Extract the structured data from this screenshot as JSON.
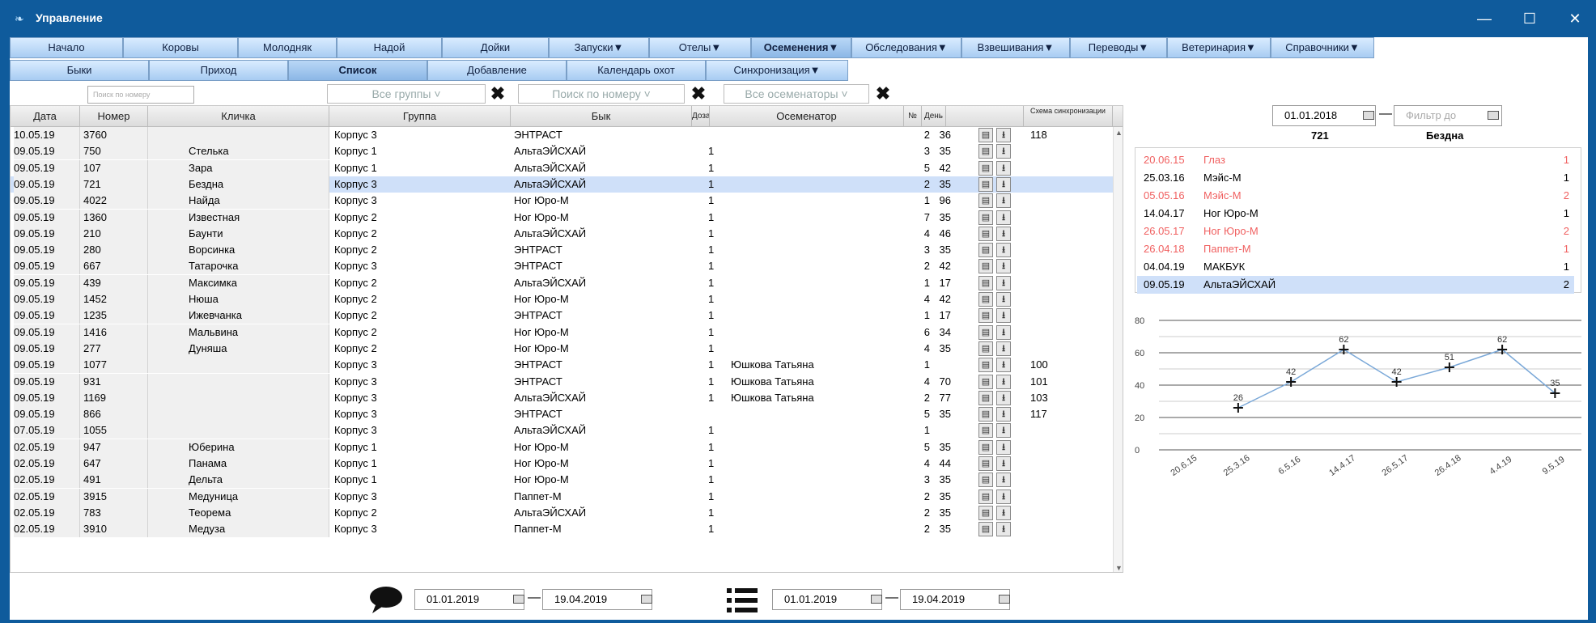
{
  "window": {
    "title": "Управление"
  },
  "menu": [
    "Начало",
    "Коровы",
    "Молодняк",
    "Надой",
    "Дойки",
    "Запуски▼",
    "Отелы▼",
    "Осеменения▼",
    "Обследования▼",
    "Взвешивания▼",
    "Переводы▼",
    "Ветеринария▼",
    "Справочники▼"
  ],
  "submenu": [
    "Быки",
    "Приход",
    "Список",
    "Добавление",
    "Календарь охот",
    "Синхронизация▼"
  ],
  "filters": {
    "number_search": "Поиск по номеру",
    "groups": "Все группы",
    "bull_search": "Поиск по номеру",
    "inseminators": "Все осеменаторы"
  },
  "columns": [
    "Дата",
    "Номер",
    "Кличка",
    "Группа",
    "Бык",
    "Доза",
    "Осеменатор",
    "№",
    "День",
    "",
    "Схема синхронизации"
  ],
  "rows": [
    [
      "10.05.19",
      "3760",
      "",
      "Корпус 3",
      "ЭНТРАСТ",
      "",
      "",
      "2",
      "36",
      "118"
    ],
    [
      "09.05.19",
      "750",
      "Стелька",
      "Корпус 1",
      "АльтаЭЙСХАЙ",
      "1",
      "",
      "3",
      "35",
      ""
    ],
    [
      "09.05.19",
      "107",
      "Зара",
      "Корпус 1",
      "АльтаЭЙСХАЙ",
      "1",
      "",
      "5",
      "42",
      ""
    ],
    [
      "09.05.19",
      "721",
      "Бездна",
      "Корпус 3",
      "АльтаЭЙСХАЙ",
      "1",
      "",
      "2",
      "35",
      ""
    ],
    [
      "09.05.19",
      "4022",
      "Найда",
      "Корпус 3",
      "Ног Юро-М",
      "1",
      "",
      "1",
      "96",
      ""
    ],
    [
      "09.05.19",
      "1360",
      "Известная",
      "Корпус 2",
      "Ног Юро-М",
      "1",
      "",
      "7",
      "35",
      ""
    ],
    [
      "09.05.19",
      "210",
      "Баунти",
      "Корпус 2",
      "АльтаЭЙСХАЙ",
      "1",
      "",
      "4",
      "46",
      ""
    ],
    [
      "09.05.19",
      "280",
      "Ворсинка",
      "Корпус 2",
      "ЭНТРАСТ",
      "1",
      "",
      "3",
      "35",
      ""
    ],
    [
      "09.05.19",
      "667",
      "Татарочка",
      "Корпус 3",
      "ЭНТРАСТ",
      "1",
      "",
      "2",
      "42",
      ""
    ],
    [
      "09.05.19",
      "439",
      "Максимка",
      "Корпус 2",
      "АльтаЭЙСХАЙ",
      "1",
      "",
      "1",
      "17",
      ""
    ],
    [
      "09.05.19",
      "1452",
      "Нюша",
      "Корпус 2",
      "Ног Юро-М",
      "1",
      "",
      "4",
      "42",
      ""
    ],
    [
      "09.05.19",
      "1235",
      "Ижевчанка",
      "Корпус 2",
      "ЭНТРАСТ",
      "1",
      "",
      "1",
      "17",
      ""
    ],
    [
      "09.05.19",
      "1416",
      "Мальвина",
      "Корпус 2",
      "Ног Юро-М",
      "1",
      "",
      "6",
      "34",
      ""
    ],
    [
      "09.05.19",
      "277",
      "Дуняша",
      "Корпус 2",
      "Ног Юро-М",
      "1",
      "",
      "4",
      "35",
      ""
    ],
    [
      "09.05.19",
      "1077",
      "",
      "Корпус 3",
      "ЭНТРАСТ",
      "1",
      "Юшкова Татьяна",
      "1",
      "",
      "100"
    ],
    [
      "09.05.19",
      "931",
      "",
      "Корпус 3",
      "ЭНТРАСТ",
      "1",
      "Юшкова Татьяна",
      "4",
      "70",
      "101"
    ],
    [
      "09.05.19",
      "1169",
      "",
      "Корпус 3",
      "АльтаЭЙСХАЙ",
      "1",
      "Юшкова Татьяна",
      "2",
      "77",
      "103"
    ],
    [
      "09.05.19",
      "866",
      "",
      "Корпус 3",
      "ЭНТРАСТ",
      "",
      "",
      "5",
      "35",
      "117"
    ],
    [
      "07.05.19",
      "1055",
      "",
      "Корпус 3",
      "АльтаЭЙСХАЙ",
      "1",
      "",
      "1",
      "",
      ""
    ],
    [
      "02.05.19",
      "947",
      "Юберина",
      "Корпус 1",
      "Ног Юро-М",
      "1",
      "",
      "5",
      "35",
      ""
    ],
    [
      "02.05.19",
      "647",
      "Панама",
      "Корпус 1",
      "Ног Юро-М",
      "1",
      "",
      "4",
      "44",
      ""
    ],
    [
      "02.05.19",
      "491",
      "Дельта",
      "Корпус 1",
      "Ног Юро-М",
      "1",
      "",
      "3",
      "35",
      ""
    ],
    [
      "02.05.19",
      "3915",
      "Медуница",
      "Корпус 3",
      "Паппет-М",
      "1",
      "",
      "2",
      "35",
      ""
    ],
    [
      "02.05.19",
      "783",
      "Теорема",
      "Корпус 2",
      "АльтаЭЙСХАЙ",
      "1",
      "",
      "2",
      "35",
      ""
    ],
    [
      "02.05.19",
      "3910",
      "Медуза",
      "Корпус 3",
      "Паппет-М",
      "1",
      "",
      "2",
      "35",
      ""
    ]
  ],
  "right": {
    "date_from": "01.01.2018",
    "filter_to": "Фильтр до",
    "cow_number": "721",
    "cow_name": "Бездна",
    "history": [
      {
        "date": "20.06.15",
        "bull": "Глаз",
        "count": "1",
        "red": true
      },
      {
        "date": "25.03.16",
        "bull": "Мэйс-М",
        "count": "1",
        "red": false
      },
      {
        "date": "05.05.16",
        "bull": "Мэйс-М",
        "count": "2",
        "red": true
      },
      {
        "date": "14.04.17",
        "bull": "Ног Юро-М",
        "count": "1",
        "red": false
      },
      {
        "date": "26.05.17",
        "bull": "Ног Юро-М",
        "count": "2",
        "red": true
      },
      {
        "date": "26.04.18",
        "bull": "Паппет-М",
        "count": "1",
        "red": true
      },
      {
        "date": "04.04.19",
        "bull": "МАКБУК",
        "count": "1",
        "red": false
      },
      {
        "date": "09.05.19",
        "bull": "АльтаЭЙСХАЙ",
        "count": "2",
        "red": false
      }
    ]
  },
  "chart_data": {
    "type": "line",
    "x": [
      "20.6.15",
      "25.3.16",
      "6.5.16",
      "14.4.17",
      "26.5.17",
      "26.4.18",
      "4.4.19",
      "9.5.19"
    ],
    "values": [
      null,
      26,
      42,
      62,
      42,
      51,
      62,
      35
    ],
    "ylim": [
      0,
      80
    ],
    "yticks": [
      0,
      20,
      40,
      60,
      80
    ],
    "color": "#7aa8d8"
  },
  "bottom": {
    "left_from": "01.01.2019",
    "left_to": "19.04.2019",
    "right_from": "01.01.2019",
    "right_to": "19.04.2019"
  }
}
